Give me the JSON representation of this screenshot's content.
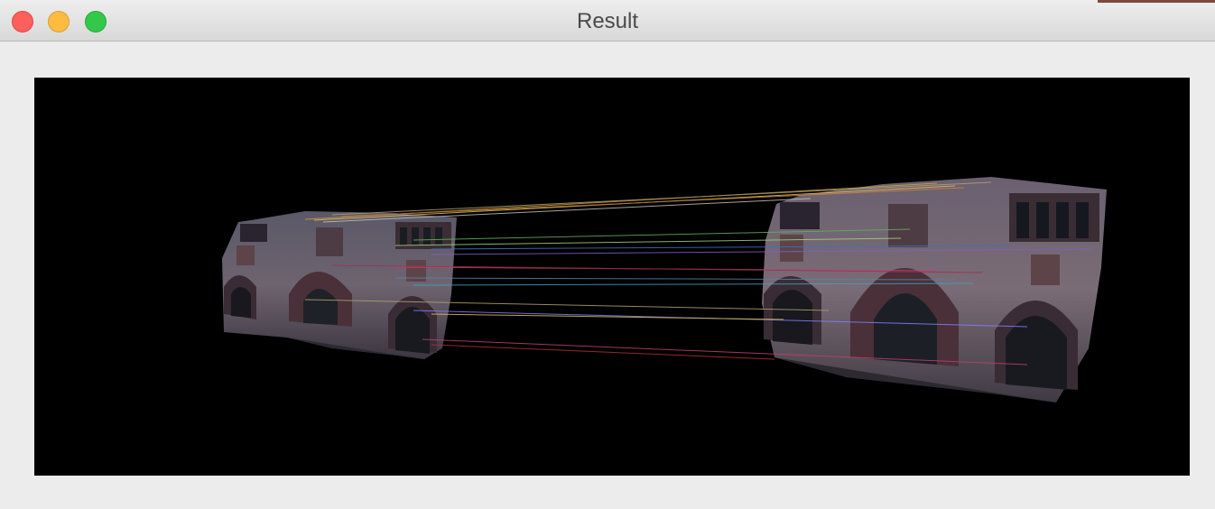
{
  "window": {
    "title": "Result",
    "controls": {
      "close": "close",
      "minimize": "minimize",
      "zoom": "zoom"
    }
  },
  "image": {
    "description_icon": "feature-matches-image",
    "background": "#000000",
    "match_line_colors": [
      "#c8a040",
      "#e0c060",
      "#d08040",
      "#b0a070",
      "#60b060",
      "#a0d080",
      "#4070c0",
      "#8080ff",
      "#c04070",
      "#a03050",
      "#6080a0",
      "#40a0c0",
      "#c0c0c0",
      "#8060c0",
      "#b03030"
    ]
  }
}
